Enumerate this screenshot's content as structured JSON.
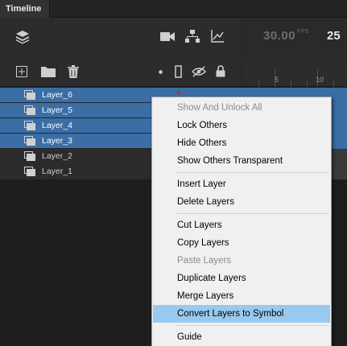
{
  "panel": {
    "tab_label": "Timeline"
  },
  "toolbar": {
    "fps_value": "30.00",
    "fps_unit": "FPS",
    "current_frame": "25"
  },
  "ruler": {
    "labels": [
      "5",
      "10"
    ]
  },
  "layers": [
    {
      "name": "Layer_6",
      "selected": true,
      "marker": true
    },
    {
      "name": "Layer_5",
      "selected": true,
      "marker": false
    },
    {
      "name": "Layer_4",
      "selected": true,
      "marker": false
    },
    {
      "name": "Layer_3",
      "selected": true,
      "marker": false
    },
    {
      "name": "Layer_2",
      "selected": false,
      "marker": false
    },
    {
      "name": "Layer_1",
      "selected": false,
      "marker": false
    }
  ],
  "context_menu": {
    "items": [
      {
        "label": "Show And Unlock All",
        "disabled": true
      },
      {
        "label": "Lock Others",
        "disabled": false
      },
      {
        "label": "Hide Others",
        "disabled": false
      },
      {
        "label": "Show Others Transparent",
        "disabled": false
      },
      {
        "label": "Insert Layer",
        "disabled": false
      },
      {
        "label": "Delete Layers",
        "disabled": false
      },
      {
        "label": "Cut Layers",
        "disabled": false
      },
      {
        "label": "Copy Layers",
        "disabled": false
      },
      {
        "label": "Paste Layers",
        "disabled": true
      },
      {
        "label": "Duplicate Layers",
        "disabled": false
      },
      {
        "label": "Merge Layers",
        "disabled": false
      },
      {
        "label": "Convert Layers to Symbol",
        "disabled": false,
        "highlighted": true
      },
      {
        "label": "Guide",
        "disabled": false
      }
    ]
  },
  "colors": {
    "selected_row": "#3a6ea5",
    "menu_highlight": "#99c9ef",
    "keyframe_marker": "#e02020"
  }
}
